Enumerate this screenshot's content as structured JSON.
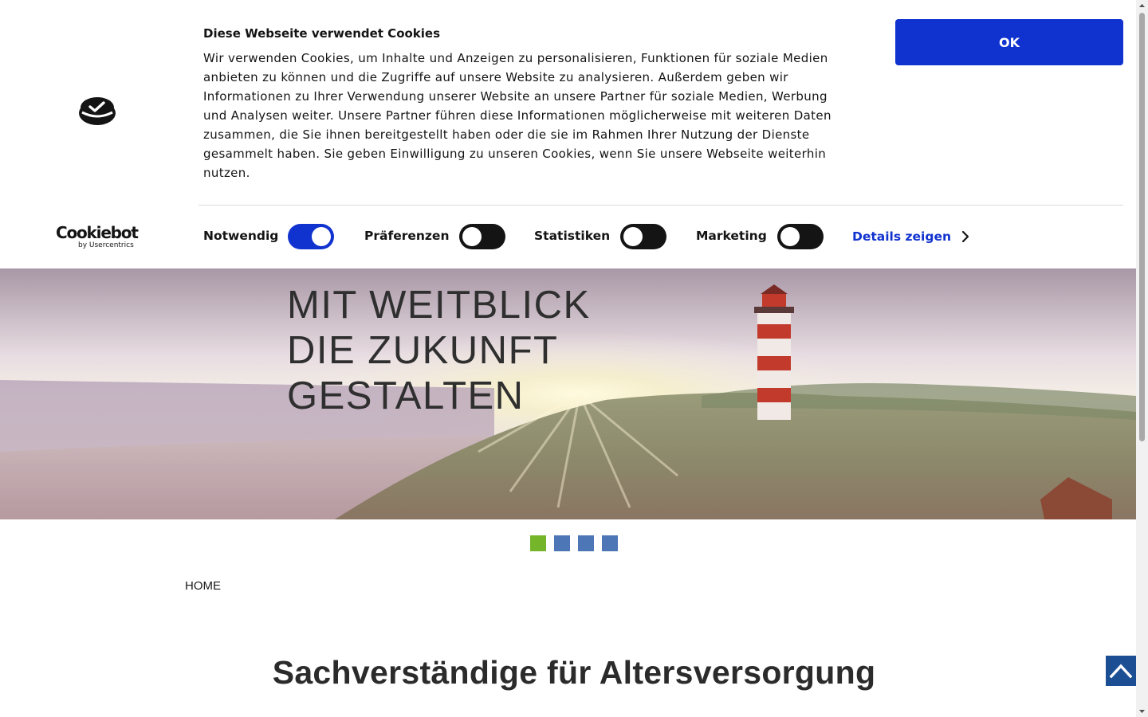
{
  "cookie_banner": {
    "brand_name": "Cookiebot",
    "brand_sub": "by Usercentrics",
    "title": "Diese Webseite verwendet Cookies",
    "text": "Wir verwenden Cookies, um Inhalte und Anzeigen zu personalisieren, Funktionen für soziale Medien anbieten zu können und die Zugriffe auf unsere Website zu analysieren. Außerdem geben wir Informationen zu Ihrer Verwendung unserer Website an unsere Partner für soziale Medien, Werbung und Analysen weiter. Unsere Partner führen diese Informationen möglicherweise mit weiteren Daten zusammen, die Sie ihnen bereitgestellt haben oder die sie im Rahmen Ihrer Nutzung der Dienste gesammelt haben. Sie geben Einwilligung zu unseren Cookies, wenn Sie unsere Webseite weiterhin nutzen.",
    "ok_label": "OK",
    "toggles": [
      {
        "label": "Notwendig",
        "checked": true
      },
      {
        "label": "Präferenzen",
        "checked": false
      },
      {
        "label": "Statistiken",
        "checked": false
      },
      {
        "label": "Marketing",
        "checked": false
      }
    ],
    "details_label": "Details zeigen",
    "accent_color": "#1032cf"
  },
  "hero": {
    "headline_lines": [
      "MIT WEITBLICK",
      "DIE ZUKUNFT",
      "GESTALTEN"
    ]
  },
  "slider": {
    "slide_count": 4,
    "active_index": 0,
    "active_color": "#74b52a",
    "inactive_color": "#4c76b5"
  },
  "breadcrumb": {
    "home_label": "HOME"
  },
  "main": {
    "title": "Sachverständige für Altersversorgung"
  },
  "icons": {
    "back_to_top": "chevron-up-icon",
    "details_chevron": "chevron-right-icon",
    "cookiebot_logo": "cookiebot-logo-icon"
  }
}
